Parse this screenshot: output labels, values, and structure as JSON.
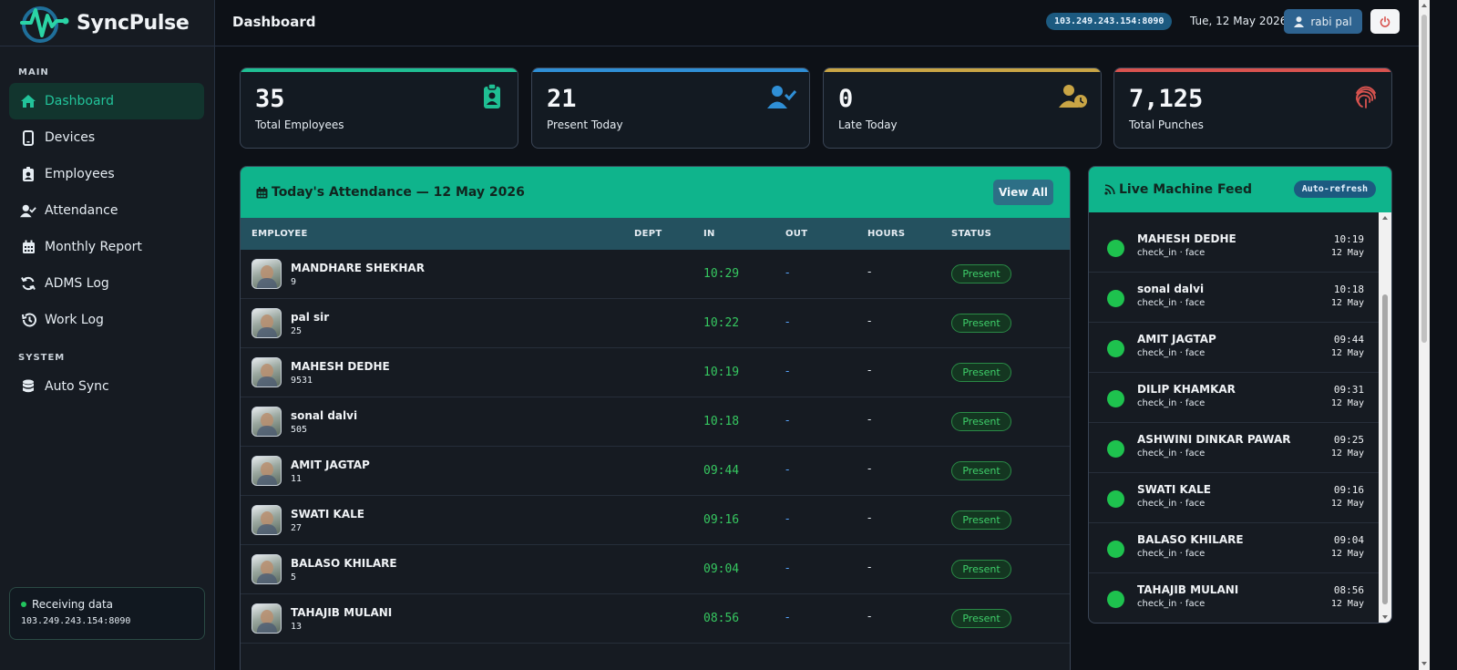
{
  "brand": {
    "name": "SyncPulse"
  },
  "sidebar": {
    "main_section": "MAIN",
    "system_section": "SYSTEM",
    "main_items": [
      {
        "label": "Dashboard",
        "icon": "home-icon",
        "active": true
      },
      {
        "label": "Devices",
        "icon": "device-icon"
      },
      {
        "label": "Employees",
        "icon": "id-badge-icon"
      },
      {
        "label": "Attendance",
        "icon": "user-check-icon"
      },
      {
        "label": "Monthly Report",
        "icon": "calendar-icon"
      },
      {
        "label": "ADMS Log",
        "icon": "refresh-icon"
      },
      {
        "label": "Work Log",
        "icon": "history-icon"
      }
    ],
    "system_items": [
      {
        "label": "Auto Sync",
        "icon": "database-icon"
      }
    ],
    "status": {
      "label": "Receiving data",
      "address": "103.249.243.154:8090"
    }
  },
  "topbar": {
    "title": "Dashboard",
    "ip": "103.249.243.154:8090",
    "date": "Tue, 12 May 2026",
    "user": "rabi pal"
  },
  "stats": [
    {
      "value": "35",
      "label": "Total Employees",
      "accent": "#1fbf93",
      "icon": "clipboard-user-icon"
    },
    {
      "value": "21",
      "label": "Present Today",
      "accent": "#2f8fd6",
      "icon": "user-check-icon"
    },
    {
      "value": "0",
      "label": "Late Today",
      "accent": "#c9a545",
      "icon": "user-clock-icon"
    },
    {
      "value": "7,125",
      "label": "Total Punches",
      "accent": "#d9534f",
      "icon": "fingerprint-icon"
    }
  ],
  "attendance": {
    "title": "Today's Attendance — 12 May 2026",
    "view_all": "View All",
    "columns": {
      "employee": "EMPLOYEE",
      "dept": "DEPT",
      "in": "IN",
      "out": "OUT",
      "hours": "HOURS",
      "status": "STATUS"
    },
    "rows": [
      {
        "name": "MANDHARE SHEKHAR",
        "id": "9",
        "dept": "",
        "in": "10:29",
        "out": "-",
        "hours": "-",
        "status": "Present"
      },
      {
        "name": "pal sir",
        "id": "25",
        "dept": "",
        "in": "10:22",
        "out": "-",
        "hours": "-",
        "status": "Present"
      },
      {
        "name": "MAHESH DEDHE",
        "id": "9531",
        "dept": "",
        "in": "10:19",
        "out": "-",
        "hours": "-",
        "status": "Present"
      },
      {
        "name": "sonal dalvi",
        "id": "505",
        "dept": "",
        "in": "10:18",
        "out": "-",
        "hours": "-",
        "status": "Present"
      },
      {
        "name": "AMIT JAGTAP",
        "id": "11",
        "dept": "",
        "in": "09:44",
        "out": "-",
        "hours": "-",
        "status": "Present"
      },
      {
        "name": "SWATI KALE",
        "id": "27",
        "dept": "",
        "in": "09:16",
        "out": "-",
        "hours": "-",
        "status": "Present"
      },
      {
        "name": "BALASO KHILARE",
        "id": "5",
        "dept": "",
        "in": "09:04",
        "out": "-",
        "hours": "-",
        "status": "Present"
      },
      {
        "name": "TAHAJIB MULANI",
        "id": "13",
        "dept": "",
        "in": "08:56",
        "out": "-",
        "hours": "-",
        "status": "Present"
      }
    ]
  },
  "feed": {
    "title": "Live Machine Feed",
    "badge": "Auto-refresh",
    "items": [
      {
        "name": "MAHESH DEDHE",
        "sub": "check_in · face",
        "time": "10:19",
        "date": "12 May"
      },
      {
        "name": "sonal dalvi",
        "sub": "check_in · face",
        "time": "10:18",
        "date": "12 May"
      },
      {
        "name": "AMIT JAGTAP",
        "sub": "check_in · face",
        "time": "09:44",
        "date": "12 May"
      },
      {
        "name": "DILIP KHAMKAR",
        "sub": "check_in · face",
        "time": "09:31",
        "date": "12 May"
      },
      {
        "name": "ASHWINI DINKAR PAWAR",
        "sub": "check_in · face",
        "time": "09:25",
        "date": "12 May"
      },
      {
        "name": "SWATI KALE",
        "sub": "check_in · face",
        "time": "09:16",
        "date": "12 May"
      },
      {
        "name": "BALASO KHILARE",
        "sub": "check_in · face",
        "time": "09:04",
        "date": "12 May"
      },
      {
        "name": "TAHAJIB MULANI",
        "sub": "check_in · face",
        "time": "08:56",
        "date": "12 May"
      }
    ]
  }
}
